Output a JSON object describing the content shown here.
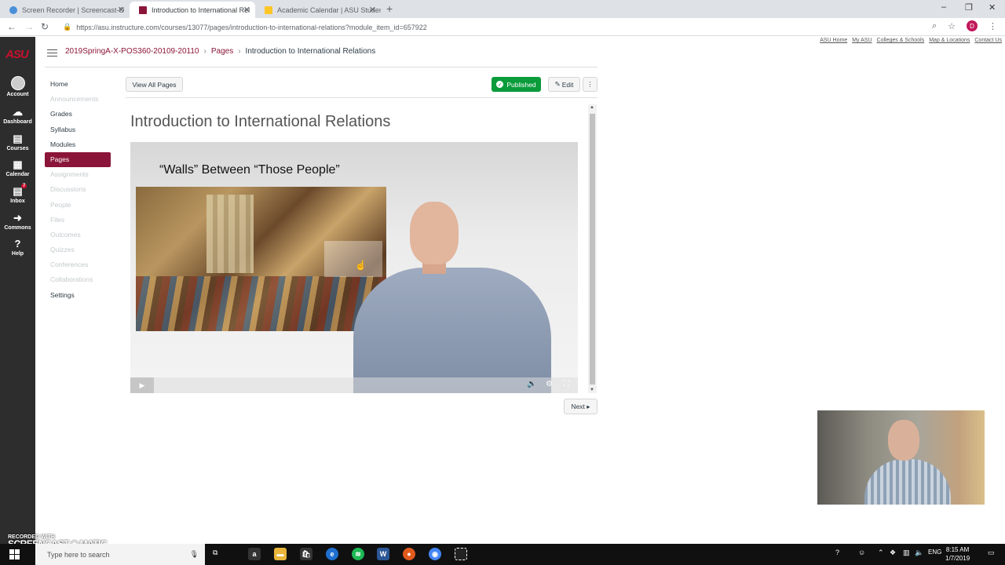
{
  "browser": {
    "tabs": [
      {
        "label": "Screen Recorder | Screencast-O",
        "fav_color": "#4a90d9",
        "active": false
      },
      {
        "label": "Introduction to International Rel",
        "fav_color": "#8b1538",
        "active": true
      },
      {
        "label": "Academic Calendar | ASU Studen",
        "fav_color": "#ffc627",
        "active": false
      }
    ],
    "new_tab": "+",
    "close": "✕",
    "url": "https://asu.instructure.com/courses/13077/pages/introduction-to-international-relations?module_item_id=657922",
    "profile_initial": "D"
  },
  "global_nav": {
    "logo": "ASU",
    "items": [
      {
        "label": "Account",
        "icon": "avatar-icon"
      },
      {
        "label": "Dashboard",
        "icon": "dashboard-icon",
        "glyph": "☁"
      },
      {
        "label": "Courses",
        "icon": "courses-icon",
        "glyph": "▤"
      },
      {
        "label": "Calendar",
        "icon": "calendar-icon",
        "glyph": "▦"
      },
      {
        "label": "Inbox",
        "icon": "inbox-icon",
        "glyph": "▤",
        "badge": "7"
      },
      {
        "label": "Commons",
        "icon": "commons-icon",
        "glyph": "➜"
      },
      {
        "label": "Help",
        "icon": "help-icon",
        "glyph": "?"
      }
    ]
  },
  "top_links": [
    "ASU Home",
    "My ASU",
    "Colleges & Schools",
    "Map & Locations",
    "Contact Us"
  ],
  "breadcrumb": {
    "course": "2019SpringA-X-POS360-20109-20110",
    "section": "Pages",
    "current": "Introduction to International Relations",
    "sep": "›"
  },
  "course_nav": [
    {
      "label": "Home",
      "state": "normal"
    },
    {
      "label": "Announcements",
      "state": "disabled"
    },
    {
      "label": "Grades",
      "state": "normal"
    },
    {
      "label": "Syllabus",
      "state": "normal"
    },
    {
      "label": "Modules",
      "state": "normal"
    },
    {
      "label": "Pages",
      "state": "active"
    },
    {
      "label": "Assignments",
      "state": "disabled"
    },
    {
      "label": "Discussions",
      "state": "disabled"
    },
    {
      "label": "People",
      "state": "disabled"
    },
    {
      "label": "Files",
      "state": "disabled"
    },
    {
      "label": "Outcomes",
      "state": "disabled"
    },
    {
      "label": "Quizzes",
      "state": "disabled"
    },
    {
      "label": "Conferences",
      "state": "disabled"
    },
    {
      "label": "Collaborations",
      "state": "disabled"
    },
    {
      "label": "Settings",
      "state": "normal"
    }
  ],
  "toolbar": {
    "view_all": "View All Pages",
    "published": "Published",
    "edit": "Edit",
    "more": "⋮"
  },
  "page": {
    "title": "Introduction to International Relations",
    "video_slide_title": "“Walls” Between “Those People”",
    "next": "Next ▸"
  },
  "taskbar": {
    "search_placeholder": "Type here to search",
    "lang": "ENG",
    "time": "8:15 AM",
    "date": "1/7/2019"
  },
  "watermark": {
    "line1": "RECORDED WITH",
    "line2": "SCREENCAST",
    "line3": "MATIC"
  },
  "colors": {
    "asu_maroon": "#8b1538",
    "published_green": "#0a9b3b",
    "nav_dark": "#2d2d2d"
  }
}
